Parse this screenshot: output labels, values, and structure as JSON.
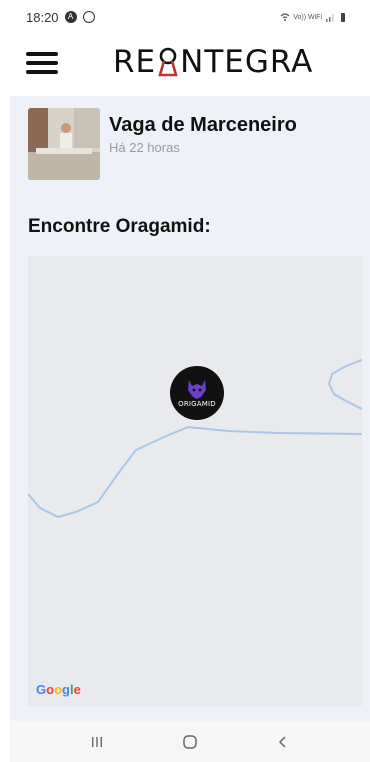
{
  "status_bar": {
    "time": "18:20",
    "network_label": "Vo)) WiFi"
  },
  "header": {
    "logo_start": "RE",
    "logo_end": "NTEGRA",
    "logo_full": "REINTEGRA"
  },
  "job": {
    "title": "Vaga de Marceneiro",
    "posted": "Há 22 horas"
  },
  "map_section": {
    "title": "Encontre Oragamid:",
    "marker_label": "ORIGAMID",
    "attribution": "Google"
  },
  "colors": {
    "content_bg": "#eef2f8",
    "map_bg": "#e9eaed",
    "road": "#a9c6ea",
    "marker": "#111111",
    "marker_accent": "#6a3fc9"
  },
  "icons": {
    "menu": "hamburger-icon",
    "nav_recent": "recent-apps-icon",
    "nav_home": "home-icon",
    "nav_back": "back-icon"
  }
}
